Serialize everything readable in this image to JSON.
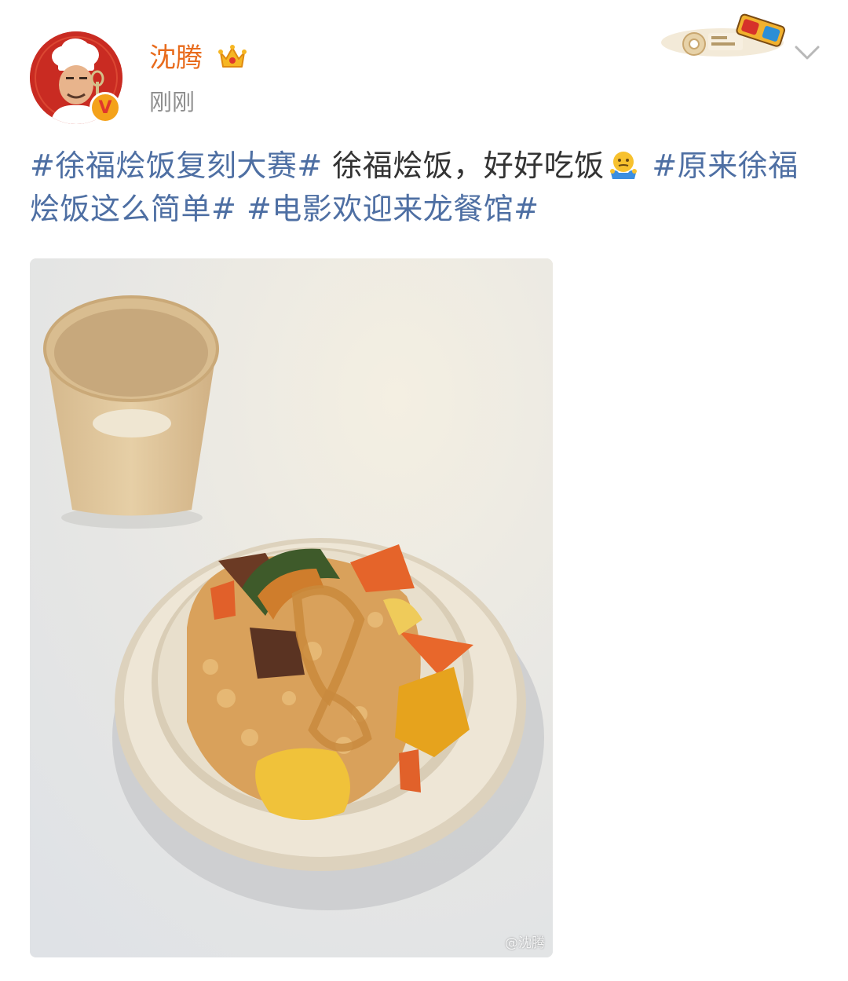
{
  "post": {
    "author": {
      "name": "沈腾"
    },
    "timestamp": "刚刚",
    "text": {
      "tag1": "#徐福烩饭复刻大赛#",
      "plain1": " 徐福烩饭，好好吃饭",
      "tag2": "#原来徐福烩饭这么简单#",
      "tag3": "#电影欢迎来龙餐馆#"
    },
    "emoji": "shrug-emoji",
    "watermark": "@沈腾"
  },
  "colors": {
    "username": "#e86b1c",
    "hashtag": "#4e6fa3",
    "timestamp": "#8e8e8e",
    "verified": "#f4a21a"
  },
  "icons": {
    "crown": "crown-icon",
    "verified": "verified-icon",
    "menu": "chevron-down-icon",
    "badge": "movie-glasses-badge"
  }
}
